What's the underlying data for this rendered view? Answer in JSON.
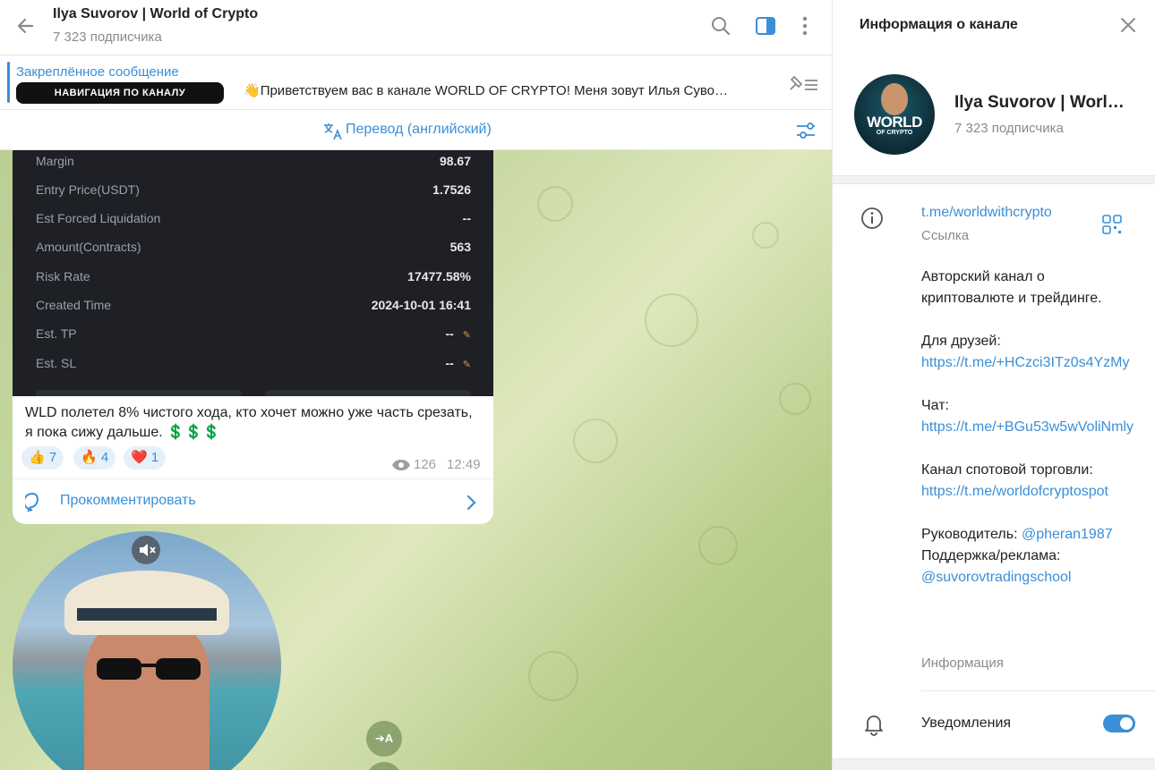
{
  "header": {
    "title": "Ilya Suvorov | World of Crypto",
    "subscribers": "7 323 подписчика"
  },
  "pinned": {
    "title": "Закреплённое сообщение",
    "badge": "НАВИГАЦИЯ ПО КАНАЛУ",
    "emoji": "👋",
    "text": "Приветствуем вас в канале WORLD OF CRYPTO!  Меня зовут Илья Суво…"
  },
  "translate": {
    "label": "Перевод (английский)"
  },
  "position_card": {
    "rows": [
      {
        "key": "Margin",
        "value": "98.67"
      },
      {
        "key": "Entry Price(USDT)",
        "value": "1.7526"
      },
      {
        "key": "Est Forced Liquidation",
        "value": "--"
      },
      {
        "key": "Amount(Contracts)",
        "value": "563"
      },
      {
        "key": "Risk Rate",
        "value": "17477.58%"
      },
      {
        "key": "Created Time",
        "value": "2024-10-01 16:41"
      },
      {
        "key": "Est. TP",
        "value": "--"
      },
      {
        "key": "Est. SL",
        "value": "--"
      }
    ]
  },
  "message": {
    "text": "WLD  полетел 8% чистого хода, кто хочет можно уже часть срезать, я пока сижу дальше. 💲💲💲",
    "reactions": [
      {
        "emoji": "👍",
        "count": "7"
      },
      {
        "emoji": "🔥",
        "count": "4"
      },
      {
        "emoji": "❤️",
        "count": "1"
      }
    ],
    "views": "126",
    "time": "12:49",
    "comment_label": "Прокомментировать"
  },
  "fab": {
    "translate_label": "➔A"
  },
  "info": {
    "header_title": "Информация о канале",
    "avatar_world": "WORLD",
    "avatar_crypto": "OF CRYPTO",
    "name": "Ilya Suvorov | Worl…",
    "subscribers": "7 323 подписчика",
    "link": "t.me/worldwithcrypto",
    "link_label": "Ссылка",
    "desc_intro": "Авторский канал о криптовалюте и трейдинге.",
    "friends_label": "Для друзей:",
    "friends_link": "https://t.me/+HCzci3ITz0s4YzMy",
    "chat_label": "Чат:",
    "chat_link": "https://t.me/+BGu53w5wVoliNmly",
    "spot_label": "Канал спотовой торговли:",
    "spot_link": "https://t.me/worldofcryptospot",
    "head_label": "Руководитель: ",
    "head_link": "@pheran1987",
    "support_label": "Поддержка/реклама:",
    "support_link": "@suvorovtradingschool",
    "desc_label": "Информация",
    "notifications_label": "Уведомления",
    "notifications_on": true
  },
  "colors": {
    "accent": "#3a8fd6",
    "card_bg": "#1e2026"
  }
}
